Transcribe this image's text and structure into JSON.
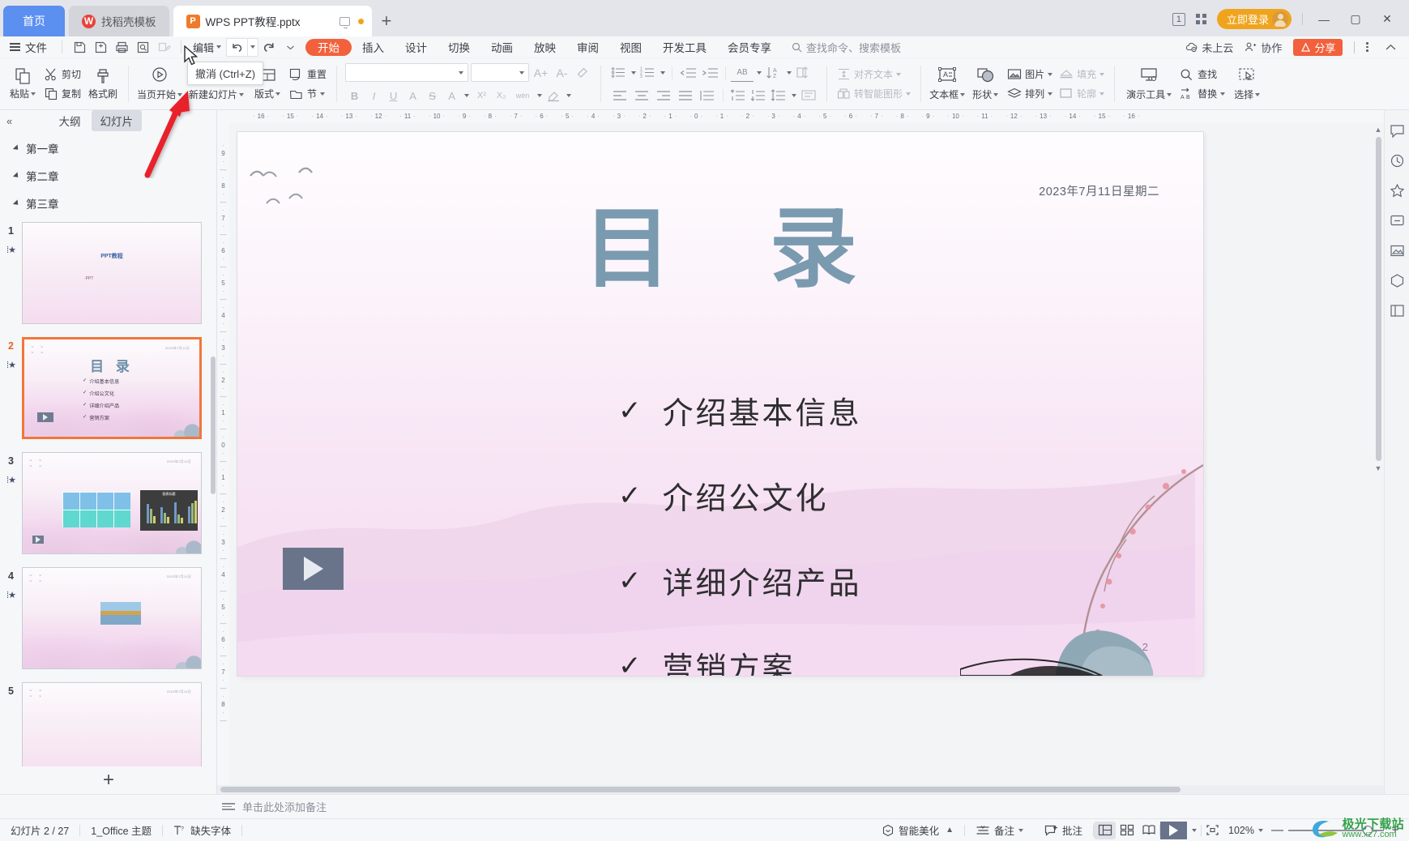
{
  "window": {
    "tabs": [
      {
        "label": "首页",
        "icon": "home-tab",
        "style": "home"
      },
      {
        "label": "找稻壳模板",
        "icon": "daoke-icon",
        "style": "gray"
      },
      {
        "label": "WPS PPT教程.pptx",
        "icon": "wps-ppt-icon",
        "style": "active"
      }
    ],
    "new_tab_label": "+",
    "screen_badge": "1",
    "login_label": "立即登录",
    "minimize": "—",
    "maximize": "▢",
    "close": "✕"
  },
  "menubar": {
    "file_label": "文件",
    "quick_icons": [
      "save-icon",
      "save-as-icon",
      "print-icon",
      "print-preview-icon",
      "edit-doc-icon"
    ],
    "edit_label": "编辑",
    "undo_label": "撤消",
    "redo_label": "重做",
    "tabs": [
      {
        "label": "开始",
        "active": true
      },
      {
        "label": "插入",
        "active": false
      },
      {
        "label": "设计",
        "active": false
      },
      {
        "label": "切换",
        "active": false
      },
      {
        "label": "动画",
        "active": false
      },
      {
        "label": "放映",
        "active": false
      },
      {
        "label": "审阅",
        "active": false
      },
      {
        "label": "视图",
        "active": false
      },
      {
        "label": "开发工具",
        "active": false
      },
      {
        "label": "会员专享",
        "active": false
      }
    ],
    "search_placeholder": "查找命令、搜索模板",
    "cloud_label": "未上云",
    "collab_label": "协作",
    "share_label": "分享"
  },
  "tooltip": {
    "text": "撤消 (Ctrl+Z)"
  },
  "ribbon": {
    "clipboard": {
      "paste": "粘贴",
      "cut": "剪切",
      "copy": "复制",
      "format_brush": "格式刷"
    },
    "slides": {
      "start_from_page": "当页开始",
      "new_slide": "新建幻灯片",
      "layout": "版式",
      "reset": "重置",
      "section": "节"
    },
    "font": {
      "family_value": "",
      "size_value": "",
      "grow": "A+",
      "shrink": "A-",
      "clear_format": "清除格式",
      "bold": "B",
      "italic": "I",
      "underline": "U",
      "shadow": "A",
      "strike": "S",
      "font_color": "A",
      "superscript": "X²",
      "subscript": "X₂",
      "phonetic": "wén",
      "highlight": "突出显示"
    },
    "paragraph": {
      "bullets": "项目符号",
      "numbering": "编号",
      "decrease_indent": "减少缩进",
      "increase_indent": "增加缩进",
      "text_direction": "AB",
      "sort": "排序",
      "align_left": "左对齐",
      "align_center": "居中",
      "align_right": "右对齐",
      "justify": "两端对齐",
      "distribute": "分散对齐",
      "line_space_before": "段前",
      "line_space_after": "段后",
      "line_spacing": "行距",
      "columns": "分栏",
      "align_text": "对齐文本",
      "to_smartart": "转智能图形"
    },
    "insert": {
      "textbox": "文本框",
      "shape": "形状",
      "picture": "图片",
      "arrange": "排列",
      "fill": "填充",
      "outline": "轮廓"
    },
    "tools": {
      "present_tools": "演示工具",
      "find": "查找",
      "replace": "替换",
      "select": "选择"
    }
  },
  "left_panel": {
    "collapse_label": "«",
    "tabs": [
      {
        "label": "大纲",
        "active": false
      },
      {
        "label": "幻灯片",
        "active": true
      }
    ],
    "chapters": [
      {
        "label": "第一章"
      },
      {
        "label": "第二章"
      },
      {
        "label": "第三章"
      }
    ],
    "thumbnails": [
      {
        "number": "1",
        "selected": false,
        "kind": "cover",
        "title": "PPT教程",
        "sub": "·PPT"
      },
      {
        "number": "2",
        "selected": true,
        "kind": "toc",
        "title": "目 录",
        "items": [
          "介绍基本信息",
          "介绍公文化",
          "详细介绍产品",
          "营销方案"
        ]
      },
      {
        "number": "3",
        "selected": false,
        "kind": "gallery",
        "chart_title": "图表标题"
      },
      {
        "number": "4",
        "selected": false,
        "kind": "photo"
      },
      {
        "number": "5",
        "selected": false,
        "kind": "blank"
      }
    ],
    "add_slide_label": "+"
  },
  "slide": {
    "date": "2023年7月11日星期二",
    "title": "目 录",
    "bullets": [
      {
        "check": "✓",
        "text": "介绍基本信息"
      },
      {
        "check": "✓",
        "text": "介绍公文化"
      },
      {
        "check": "✓",
        "text": "详细介绍产品"
      },
      {
        "check": "✓",
        "text": "营销方案"
      }
    ],
    "page_number": "2",
    "video_placeholder": "video-play-icon"
  },
  "rulers": {
    "horizontal": [
      "16",
      "15",
      "14",
      "13",
      "12",
      "11",
      "10",
      "9",
      "8",
      "7",
      "6",
      "5",
      "4",
      "3",
      "2",
      "1",
      "0",
      "1",
      "2",
      "3",
      "4",
      "5",
      "6",
      "7",
      "8",
      "9",
      "10",
      "11",
      "12",
      "13",
      "14",
      "15",
      "16"
    ],
    "vertical": [
      "9",
      "8",
      "7",
      "6",
      "5",
      "4",
      "3",
      "2",
      "1",
      "0",
      "1",
      "2",
      "3",
      "4",
      "5",
      "6",
      "7",
      "8"
    ]
  },
  "notes": {
    "placeholder": "单击此处添加备注"
  },
  "statusbar": {
    "slide_count": "幻灯片 2 / 27",
    "theme": "1_Office 主题",
    "missing_font": "缺失字体",
    "beautify": "智能美化",
    "notes_btn": "备注",
    "comment_btn": "批注",
    "views": [
      "normal-view",
      "sorter-view",
      "reading-view"
    ],
    "play": "play-icon",
    "fit_label": "适应窗口",
    "zoom": "102%",
    "zoom_minus": "—",
    "zoom_plus": "+"
  },
  "right_rail": [
    "feedback-icon",
    "history-icon",
    "star-icon",
    "screen-icon",
    "image-icon",
    "resource-icon",
    "library-icon"
  ],
  "watermark": {
    "text": "极光下载站",
    "url": "www.xz7.com"
  },
  "colors": {
    "accent_orange": "#f2613c",
    "tab_home_blue": "#5b8ff0",
    "login_amber": "#f0a41e",
    "title_blue": "#7a9ab0",
    "selected_border": "#f2763c"
  }
}
